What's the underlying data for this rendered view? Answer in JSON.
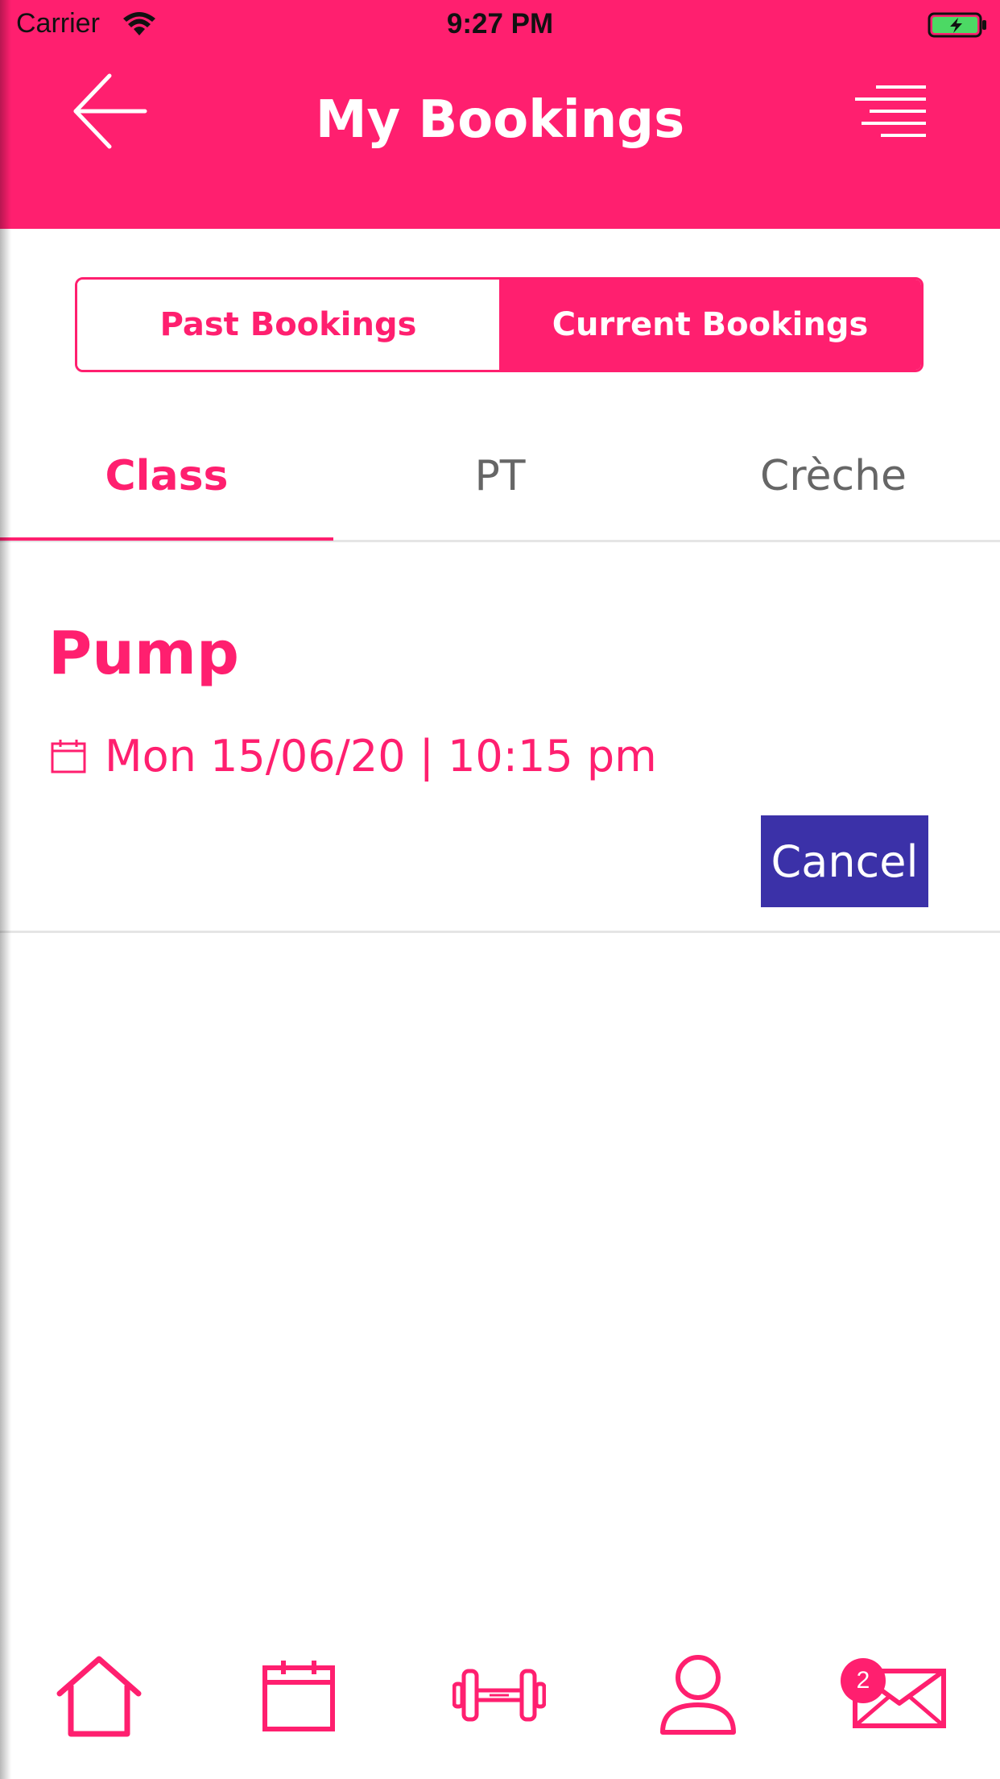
{
  "status_bar": {
    "carrier": "Carrier",
    "time": "9:27 PM",
    "icons": [
      "wifi-icon",
      "battery-charging-icon"
    ]
  },
  "header": {
    "title": "My Bookings",
    "back_icon": "arrow-left-icon",
    "menu_icon": "hamburger-menu-icon",
    "background_color": "#ff1f6f"
  },
  "segmented": {
    "past_label": "Past Bookings",
    "current_label": "Current Bookings",
    "selected": "Current Bookings"
  },
  "tabs": [
    {
      "label": "Class",
      "active": true
    },
    {
      "label": "PT",
      "active": false
    },
    {
      "label": "Crèche",
      "active": false
    }
  ],
  "booking": {
    "title": "Pump",
    "date_icon": "calendar-icon",
    "datetime": "Mon 15/06/20 | 10:15 pm",
    "cancel_label": "Cancel",
    "cancel_color": "#3b31a8"
  },
  "bottom_nav": {
    "items": [
      "home-icon",
      "calendar-icon",
      "dumbbell-icon",
      "profile-icon",
      "mail-icon"
    ],
    "mail_badge": "2"
  },
  "colors": {
    "accent": "#ff1f6f",
    "text_inactive": "#666666",
    "divider": "#e5e5e5"
  }
}
